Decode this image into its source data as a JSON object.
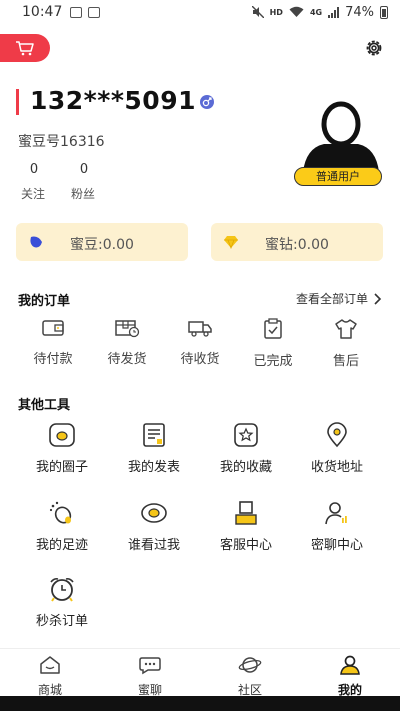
{
  "status_bar": {
    "time": "10:47",
    "network": "HD",
    "network_type": "4G",
    "battery": "74%"
  },
  "profile": {
    "phone": "132***5091",
    "id_label": "蜜豆号16316",
    "following_count": "0",
    "following_label": "关注",
    "fans_count": "0",
    "fans_label": "粉丝",
    "user_level": "普通用户"
  },
  "balance": {
    "midou": "蜜豆:0.00",
    "mizuan": "蜜钻:0.00"
  },
  "orders": {
    "title": "我的订单",
    "see_all": "查看全部订单",
    "items": [
      {
        "label": "待付款",
        "icon": "wallet-icon"
      },
      {
        "label": "待发货",
        "icon": "package-clock-icon"
      },
      {
        "label": "待收货",
        "icon": "truck-icon"
      },
      {
        "label": "已完成",
        "icon": "clipboard-check-icon"
      },
      {
        "label": "售后",
        "icon": "shirt-icon"
      }
    ]
  },
  "tools": {
    "title": "其他工具",
    "items": [
      {
        "label": "我的圈子",
        "icon": "circle-icon"
      },
      {
        "label": "我的发表",
        "icon": "document-icon"
      },
      {
        "label": "我的收藏",
        "icon": "star-icon"
      },
      {
        "label": "收货地址",
        "icon": "location-pin-icon"
      },
      {
        "label": "我的足迹",
        "icon": "footprint-icon"
      },
      {
        "label": "谁看过我",
        "icon": "eye-icon"
      },
      {
        "label": "客服中心",
        "icon": "customer-service-icon"
      },
      {
        "label": "密聊中心",
        "icon": "private-chat-icon"
      },
      {
        "label": "秒杀订单",
        "icon": "alarm-clock-icon"
      }
    ]
  },
  "nav": {
    "items": [
      {
        "label": "商城",
        "icon": "home-icon"
      },
      {
        "label": "蜜聊",
        "icon": "chat-icon"
      },
      {
        "label": "社区",
        "icon": "planet-icon"
      },
      {
        "label": "我的",
        "icon": "user-icon"
      }
    ],
    "active": "我的"
  },
  "colors": {
    "accent_red": "#ef3b48",
    "accent_yellow": "#fbcb18",
    "card_bg": "#fdf1d0"
  }
}
